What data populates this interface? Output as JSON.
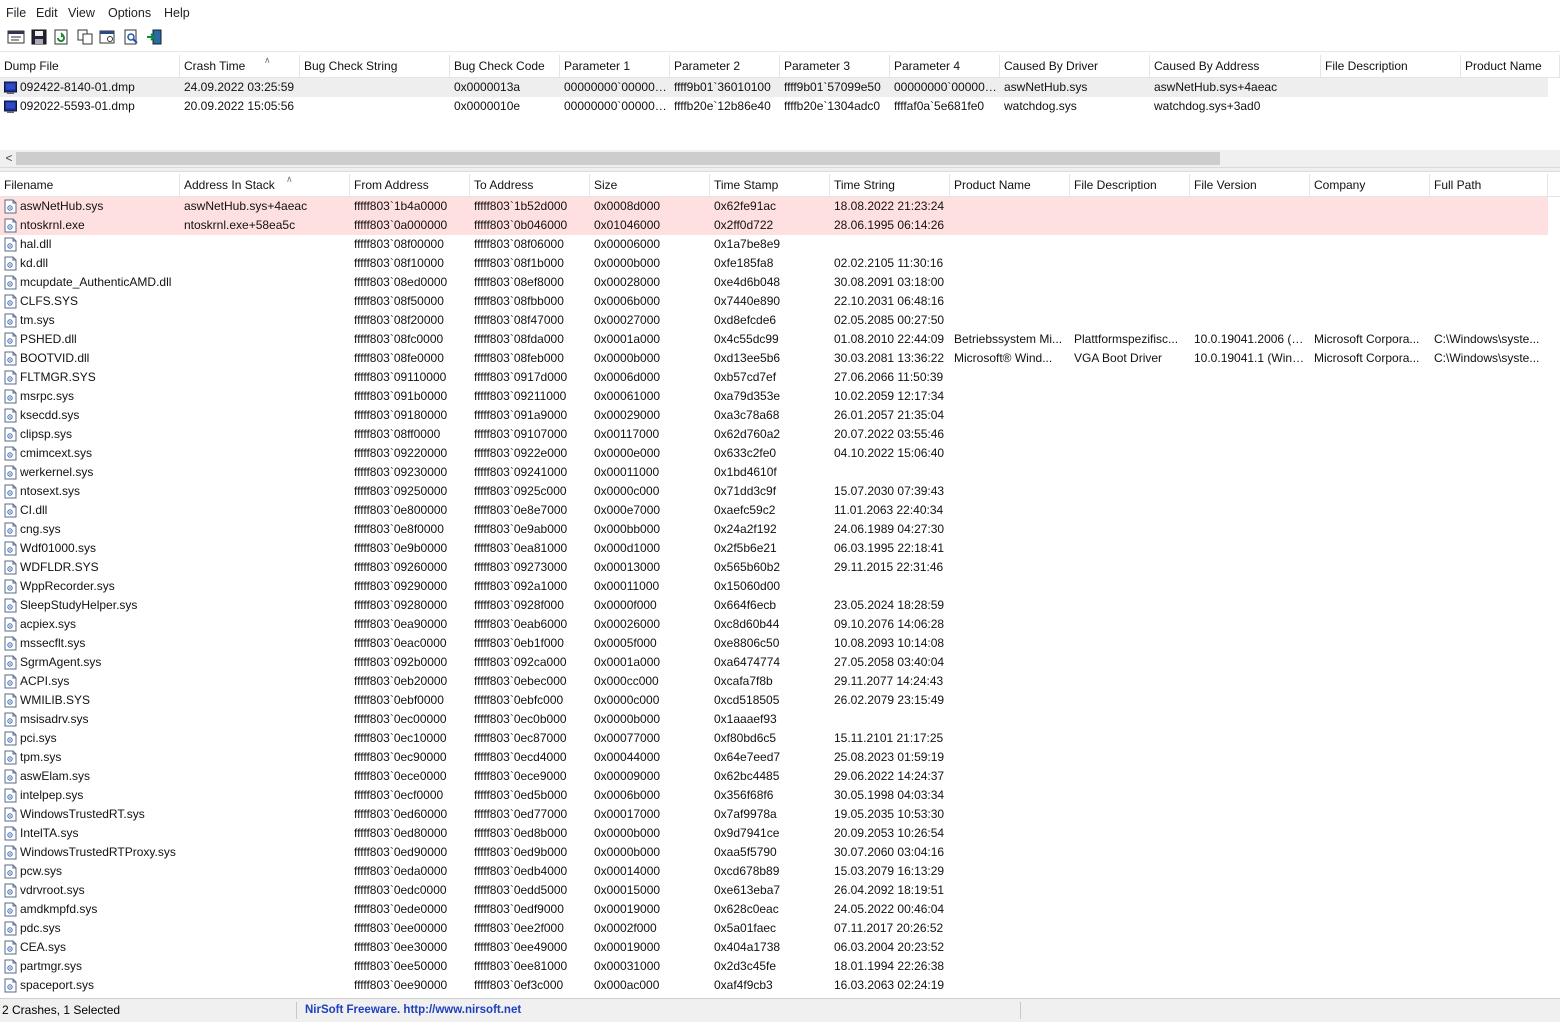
{
  "menu": [
    "File",
    "Edit",
    "View",
    "Options",
    "Help"
  ],
  "toolbar": {
    "buttons": [
      "properties-icon",
      "save-icon",
      "refresh-icon",
      "copy-icon",
      "advanced-options-icon",
      "find-icon",
      "exit-icon"
    ]
  },
  "crashes": {
    "columns": [
      "Dump File",
      "Crash Time",
      "Bug Check String",
      "Bug Check Code",
      "Parameter 1",
      "Parameter 2",
      "Parameter 3",
      "Parameter 4",
      "Caused By Driver",
      "Caused By Address",
      "File Description",
      "Product Name"
    ],
    "sort_column": "Crash Time",
    "rows": [
      [
        "092422-8140-01.dmp",
        "24.09.2022 03:25:59",
        "",
        "0x0000013a",
        "00000000`000000...",
        "ffff9b01`36010100",
        "ffff9b01`57099e50",
        "00000000`000000...",
        "aswNetHub.sys",
        "aswNetHub.sys+4aeac",
        "",
        ""
      ],
      [
        "092022-5593-01.dmp",
        "20.09.2022 15:05:56",
        "",
        "0x0000010e",
        "00000000`000000...",
        "ffffb20e`12b86e40",
        "ffffb20e`1304adc0",
        "ffffaf0a`5e681fe0",
        "watchdog.sys",
        "watchdog.sys+3ad0",
        "",
        ""
      ]
    ],
    "selected_index": 0
  },
  "modules": {
    "columns": [
      "Filename",
      "Address In Stack",
      "From Address",
      "To Address",
      "Size",
      "Time Stamp",
      "Time String",
      "Product Name",
      "File Description",
      "File Version",
      "Company",
      "Full Path"
    ],
    "sort_column": "Address In Stack",
    "highlight_color": "#ffe0e0",
    "rows": [
      [
        "aswNetHub.sys",
        "aswNetHub.sys+4aeac",
        "fffff803`1b4a0000",
        "fffff803`1b52d000",
        "0x0008d000",
        "0x62fe91ac",
        "18.08.2022 21:23:24",
        "",
        "",
        "",
        "",
        ""
      ],
      [
        "ntoskrnl.exe",
        "ntoskrnl.exe+58ea5c",
        "fffff803`0a000000",
        "fffff803`0b046000",
        "0x01046000",
        "0x2ff0d722",
        "28.06.1995 06:14:26",
        "",
        "",
        "",
        "",
        ""
      ],
      [
        "hal.dll",
        "",
        "fffff803`08f00000",
        "fffff803`08f06000",
        "0x00006000",
        "0x1a7be8e9",
        "",
        "",
        "",
        "",
        "",
        ""
      ],
      [
        "kd.dll",
        "",
        "fffff803`08f10000",
        "fffff803`08f1b000",
        "0x0000b000",
        "0xfe185fa8",
        "02.02.2105 11:30:16",
        "",
        "",
        "",
        "",
        ""
      ],
      [
        "mcupdate_AuthenticAMD.dll",
        "",
        "fffff803`08ed0000",
        "fffff803`08ef8000",
        "0x00028000",
        "0xe4d6b048",
        "30.08.2091 03:18:00",
        "",
        "",
        "",
        "",
        ""
      ],
      [
        "CLFS.SYS",
        "",
        "fffff803`08f50000",
        "fffff803`08fbb000",
        "0x0006b000",
        "0x7440e890",
        "22.10.2031 06:48:16",
        "",
        "",
        "",
        "",
        ""
      ],
      [
        "tm.sys",
        "",
        "fffff803`08f20000",
        "fffff803`08f47000",
        "0x00027000",
        "0xd8efcde6",
        "02.05.2085 00:27:50",
        "",
        "",
        "",
        "",
        ""
      ],
      [
        "PSHED.dll",
        "",
        "fffff803`08fc0000",
        "fffff803`08fda000",
        "0x0001a000",
        "0x4c55dc99",
        "01.08.2010 22:44:09",
        "Betriebssystem Mi...",
        "Plattformspezifisc...",
        "10.0.19041.2006 (W...",
        "Microsoft Corpora...",
        "C:\\Windows\\syste..."
      ],
      [
        "BOOTVID.dll",
        "",
        "fffff803`08fe0000",
        "fffff803`08feb000",
        "0x0000b000",
        "0xd13ee5b6",
        "30.03.2081 13:36:22",
        "Microsoft® Wind...",
        "VGA Boot Driver",
        "10.0.19041.1 (WinB...",
        "Microsoft Corpora...",
        "C:\\Windows\\syste..."
      ],
      [
        "FLTMGR.SYS",
        "",
        "fffff803`09110000",
        "fffff803`0917d000",
        "0x0006d000",
        "0xb57cd7ef",
        "27.06.2066 11:50:39",
        "",
        "",
        "",
        "",
        ""
      ],
      [
        "msrpc.sys",
        "",
        "fffff803`091b0000",
        "fffff803`09211000",
        "0x00061000",
        "0xa79d353e",
        "10.02.2059 12:17:34",
        "",
        "",
        "",
        "",
        ""
      ],
      [
        "ksecdd.sys",
        "",
        "fffff803`09180000",
        "fffff803`091a9000",
        "0x00029000",
        "0xa3c78a68",
        "26.01.2057 21:35:04",
        "",
        "",
        "",
        "",
        ""
      ],
      [
        "clipsp.sys",
        "",
        "fffff803`08ff0000",
        "fffff803`09107000",
        "0x00117000",
        "0x62d760a2",
        "20.07.2022 03:55:46",
        "",
        "",
        "",
        "",
        ""
      ],
      [
        "cmimcext.sys",
        "",
        "fffff803`09220000",
        "fffff803`0922e000",
        "0x0000e000",
        "0x633c2fe0",
        "04.10.2022 15:06:40",
        "",
        "",
        "",
        "",
        ""
      ],
      [
        "werkernel.sys",
        "",
        "fffff803`09230000",
        "fffff803`09241000",
        "0x00011000",
        "0x1bd4610f",
        "",
        "",
        "",
        "",
        "",
        ""
      ],
      [
        "ntosext.sys",
        "",
        "fffff803`09250000",
        "fffff803`0925c000",
        "0x0000c000",
        "0x71dd3c9f",
        "15.07.2030 07:39:43",
        "",
        "",
        "",
        "",
        ""
      ],
      [
        "CI.dll",
        "",
        "fffff803`0e800000",
        "fffff803`0e8e7000",
        "0x000e7000",
        "0xaefc59c2",
        "11.01.2063 22:40:34",
        "",
        "",
        "",
        "",
        ""
      ],
      [
        "cng.sys",
        "",
        "fffff803`0e8f0000",
        "fffff803`0e9ab000",
        "0x000bb000",
        "0x24a2f192",
        "24.06.1989 04:27:30",
        "",
        "",
        "",
        "",
        ""
      ],
      [
        "Wdf01000.sys",
        "",
        "fffff803`0e9b0000",
        "fffff803`0ea81000",
        "0x000d1000",
        "0x2f5b6e21",
        "06.03.1995 22:18:41",
        "",
        "",
        "",
        "",
        ""
      ],
      [
        "WDFLDR.SYS",
        "",
        "fffff803`09260000",
        "fffff803`09273000",
        "0x00013000",
        "0x565b60b2",
        "29.11.2015 22:31:46",
        "",
        "",
        "",
        "",
        ""
      ],
      [
        "WppRecorder.sys",
        "",
        "fffff803`09290000",
        "fffff803`092a1000",
        "0x00011000",
        "0x15060d00",
        "",
        "",
        "",
        "",
        "",
        ""
      ],
      [
        "SleepStudyHelper.sys",
        "",
        "fffff803`09280000",
        "fffff803`0928f000",
        "0x0000f000",
        "0x664f6ecb",
        "23.05.2024 18:28:59",
        "",
        "",
        "",
        "",
        ""
      ],
      [
        "acpiex.sys",
        "",
        "fffff803`0ea90000",
        "fffff803`0eab6000",
        "0x00026000",
        "0xc8d60b44",
        "09.10.2076 14:06:28",
        "",
        "",
        "",
        "",
        ""
      ],
      [
        "mssecflt.sys",
        "",
        "fffff803`0eac0000",
        "fffff803`0eb1f000",
        "0x0005f000",
        "0xe8806c50",
        "10.08.2093 10:14:08",
        "",
        "",
        "",
        "",
        ""
      ],
      [
        "SgrmAgent.sys",
        "",
        "fffff803`092b0000",
        "fffff803`092ca000",
        "0x0001a000",
        "0xa6474774",
        "27.05.2058 03:40:04",
        "",
        "",
        "",
        "",
        ""
      ],
      [
        "ACPI.sys",
        "",
        "fffff803`0eb20000",
        "fffff803`0ebec000",
        "0x000cc000",
        "0xcafa7f8b",
        "29.11.2077 14:24:43",
        "",
        "",
        "",
        "",
        ""
      ],
      [
        "WMILIB.SYS",
        "",
        "fffff803`0ebf0000",
        "fffff803`0ebfc000",
        "0x0000c000",
        "0xcd518505",
        "26.02.2079 23:15:49",
        "",
        "",
        "",
        "",
        ""
      ],
      [
        "msisadrv.sys",
        "",
        "fffff803`0ec00000",
        "fffff803`0ec0b000",
        "0x0000b000",
        "0x1aaaef93",
        "",
        "",
        "",
        "",
        "",
        ""
      ],
      [
        "pci.sys",
        "",
        "fffff803`0ec10000",
        "fffff803`0ec87000",
        "0x00077000",
        "0xf80bd6c5",
        "15.11.2101 21:17:25",
        "",
        "",
        "",
        "",
        ""
      ],
      [
        "tpm.sys",
        "",
        "fffff803`0ec90000",
        "fffff803`0ecd4000",
        "0x00044000",
        "0x64e7eed7",
        "25.08.2023 01:59:19",
        "",
        "",
        "",
        "",
        ""
      ],
      [
        "aswElam.sys",
        "",
        "fffff803`0ece0000",
        "fffff803`0ece9000",
        "0x00009000",
        "0x62bc4485",
        "29.06.2022 14:24:37",
        "",
        "",
        "",
        "",
        ""
      ],
      [
        "intelpep.sys",
        "",
        "fffff803`0ecf0000",
        "fffff803`0ed5b000",
        "0x0006b000",
        "0x356f68f6",
        "30.05.1998 04:03:34",
        "",
        "",
        "",
        "",
        ""
      ],
      [
        "WindowsTrustedRT.sys",
        "",
        "fffff803`0ed60000",
        "fffff803`0ed77000",
        "0x00017000",
        "0x7af9978a",
        "19.05.2035 10:53:30",
        "",
        "",
        "",
        "",
        ""
      ],
      [
        "IntelTA.sys",
        "",
        "fffff803`0ed80000",
        "fffff803`0ed8b000",
        "0x0000b000",
        "0x9d7941ce",
        "20.09.2053 10:26:54",
        "",
        "",
        "",
        "",
        ""
      ],
      [
        "WindowsTrustedRTProxy.sys",
        "",
        "fffff803`0ed90000",
        "fffff803`0ed9b000",
        "0x0000b000",
        "0xaa5f5790",
        "30.07.2060 03:04:16",
        "",
        "",
        "",
        "",
        ""
      ],
      [
        "pcw.sys",
        "",
        "fffff803`0eda0000",
        "fffff803`0edb4000",
        "0x00014000",
        "0xcd678b89",
        "15.03.2079 16:13:29",
        "",
        "",
        "",
        "",
        ""
      ],
      [
        "vdrvroot.sys",
        "",
        "fffff803`0edc0000",
        "fffff803`0edd5000",
        "0x00015000",
        "0xe613eba7",
        "26.04.2092 18:19:51",
        "",
        "",
        "",
        "",
        ""
      ],
      [
        "amdkmpfd.sys",
        "",
        "fffff803`0ede0000",
        "fffff803`0edf9000",
        "0x00019000",
        "0x628c0eac",
        "24.05.2022 00:46:04",
        "",
        "",
        "",
        "",
        ""
      ],
      [
        "pdc.sys",
        "",
        "fffff803`0ee00000",
        "fffff803`0ee2f000",
        "0x0002f000",
        "0x5a01faec",
        "07.11.2017 20:26:52",
        "",
        "",
        "",
        "",
        ""
      ],
      [
        "CEA.sys",
        "",
        "fffff803`0ee30000",
        "fffff803`0ee49000",
        "0x00019000",
        "0x404a1738",
        "06.03.2004 20:23:52",
        "",
        "",
        "",
        "",
        ""
      ],
      [
        "partmgr.sys",
        "",
        "fffff803`0ee50000",
        "fffff803`0ee81000",
        "0x00031000",
        "0x2d3c45fe",
        "18.01.1994 22:26:38",
        "",
        "",
        "",
        "",
        ""
      ],
      [
        "spaceport.sys",
        "",
        "fffff803`0ee90000",
        "fffff803`0ef3c000",
        "0x000ac000",
        "0xaf4f9cb3",
        "16.03.2063 02:24:19",
        "",
        "",
        "",
        "",
        ""
      ]
    ]
  },
  "scroll_left_glyph": "<",
  "status": {
    "count": "2 Crashes, 1 Selected",
    "brand": "NirSoft Freeware.  http://www.nirsoft.net",
    "brand_color": "#1e3fbf"
  }
}
